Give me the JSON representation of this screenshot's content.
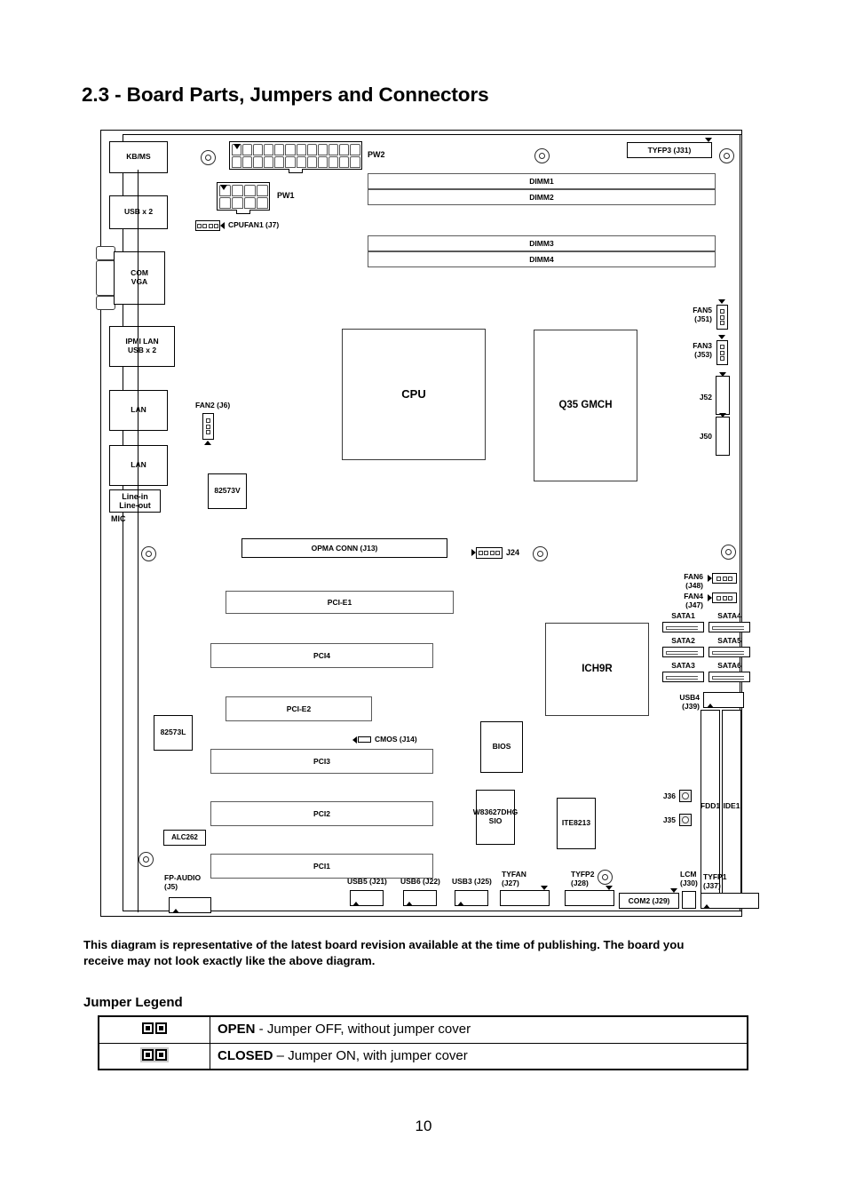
{
  "page": {
    "title": "2.3 - Board Parts, Jumpers and Connectors",
    "number": "10",
    "note": "This diagram is representative of the latest board revision available at the time of publishing.  The board you receive may not look exactly like the above diagram."
  },
  "diagram": {
    "rear_io": [
      {
        "label": "KB/MS"
      },
      {
        "label": "USB x 2"
      },
      {
        "label": "COM\nVGA"
      },
      {
        "label": "IPMI LAN\nUSB x 2"
      },
      {
        "label": "LAN"
      },
      {
        "label": "LAN"
      },
      {
        "label": "Line-in\nLine-out"
      },
      {
        "label": "MIC"
      }
    ],
    "power": [
      {
        "label": "PW2"
      },
      {
        "label": "PW1"
      }
    ],
    "fans": [
      {
        "label": "CPUFAN1 (J7)"
      },
      {
        "label": "FAN2 (J6)"
      },
      {
        "label": "FAN5\n(J51)"
      },
      {
        "label": "FAN3\n(J53)"
      },
      {
        "label": "FAN6\n(J48)"
      },
      {
        "label": "FAN4\n(J47)"
      }
    ],
    "dimms": [
      {
        "label": "DIMM1"
      },
      {
        "label": "DIMM2"
      },
      {
        "label": "DIMM3"
      },
      {
        "label": "DIMM4"
      }
    ],
    "chips": [
      {
        "label": "CPU"
      },
      {
        "label": "Q35 GMCH"
      },
      {
        "label": "ICH9R"
      },
      {
        "label": "82573V"
      },
      {
        "label": "82573L"
      },
      {
        "label": "ALC262"
      },
      {
        "label": "BIOS"
      },
      {
        "label": "W83627DHG\nSIO"
      },
      {
        "label": "ITE8213"
      }
    ],
    "slots": [
      {
        "label": "PCI-E1"
      },
      {
        "label": "PCI4"
      },
      {
        "label": "PCI-E2"
      },
      {
        "label": "PCI3"
      },
      {
        "label": "PCI2"
      },
      {
        "label": "PCI1"
      }
    ],
    "sata": [
      {
        "label": "SATA1"
      },
      {
        "label": "SATA2"
      },
      {
        "label": "SATA3"
      },
      {
        "label": "SATA4"
      },
      {
        "label": "SATA5"
      },
      {
        "label": "SATA6"
      }
    ],
    "connectors": [
      {
        "label": "TYFP3 (J31)"
      },
      {
        "label": "OPMA CONN (J13)"
      },
      {
        "label": "J24"
      },
      {
        "label": "J52"
      },
      {
        "label": "J50"
      },
      {
        "label": "CMOS (J14)"
      },
      {
        "label": "USB4\n(J39)"
      },
      {
        "label": "FDD1"
      },
      {
        "label": "IDE1"
      },
      {
        "label": "J36"
      },
      {
        "label": "J35"
      },
      {
        "label": "FP-AUDIO\n(J5)"
      },
      {
        "label": "USB5 (J21)"
      },
      {
        "label": "USB6 (J22)"
      },
      {
        "label": "USB3 (J25)"
      },
      {
        "label": "TYFAN\n(J27)"
      },
      {
        "label": "TYFP2\n(J28)"
      },
      {
        "label": "COM2 (J29)"
      },
      {
        "label": "LCM\n(J30)"
      },
      {
        "label": "TYFP1\n(J37)"
      }
    ]
  },
  "jumper_legend": {
    "title": "Jumper Legend",
    "rows": [
      {
        "state": "OPEN",
        "dash": " - ",
        "desc": "Jumper OFF, without jumper cover",
        "covered": false
      },
      {
        "state": "CLOSED",
        "dash": " – ",
        "desc": "Jumper ON, with jumper cover",
        "covered": true
      }
    ]
  }
}
